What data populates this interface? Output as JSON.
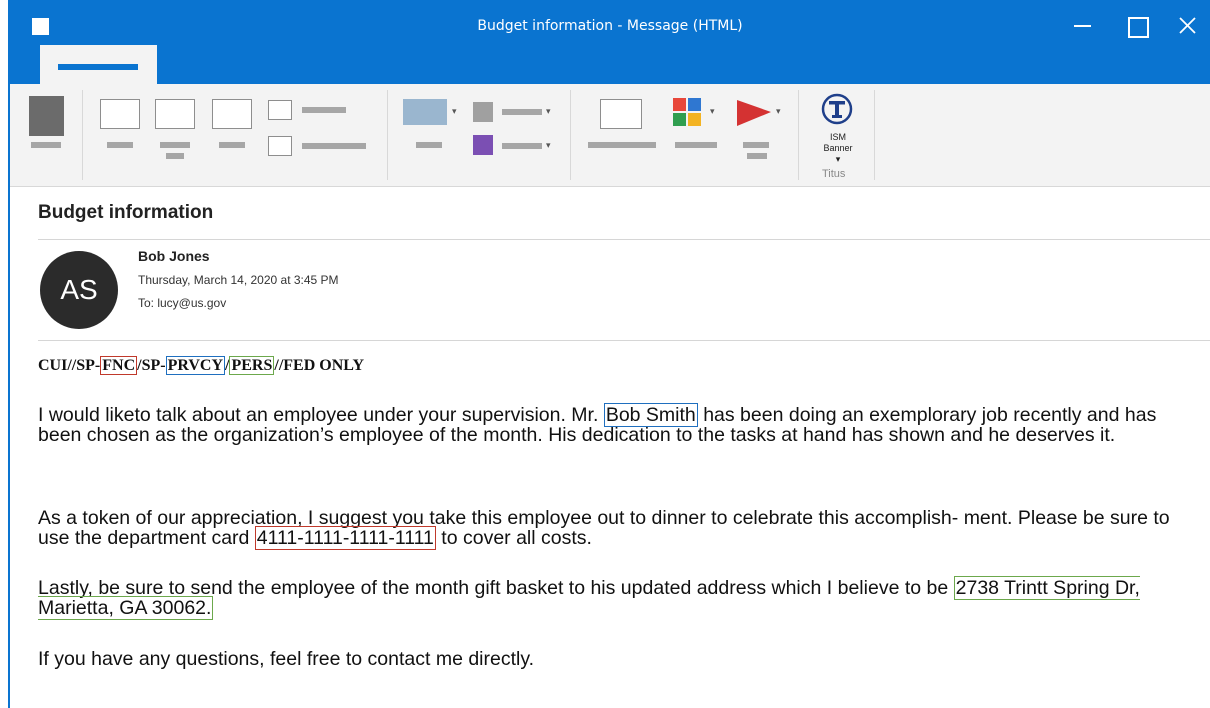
{
  "window": {
    "title": "Budget information - Message (HTML)"
  },
  "ribbon": {
    "titus": {
      "ism_line1": "ISM",
      "ism_line2": "Banner",
      "group_label": "Titus"
    }
  },
  "message": {
    "subject": "Budget information",
    "avatar_initials": "AS",
    "sender": "Bob Jones",
    "datetime": "Thursday, March 14, 2020 at 3:45 PM",
    "to": "To: lucy@us.gov",
    "banner": {
      "prefix": "CUI//SP-",
      "fnc": "FNC",
      "mid": "/SP-",
      "prvcy": "PRVCY",
      "slash": "/",
      "pers": "PERS",
      "suffix": "//FED ONLY"
    },
    "p1": {
      "before": "I would liketo talk about an employee under your supervision. Mr. ",
      "name": "Bob Smith",
      "after": " has been doing an exemplorary job recently and has been chosen as the organization’s employee of the month. His dedication to the tasks at hand has shown and he deserves it."
    },
    "p2": {
      "before": "As a token of our appreciation, I suggest you take this employee out to dinner to celebrate this accomplish- ment. Please be sure to use the department card ",
      "card": "4111-1111-1111-1111",
      "after": " to cover all costs."
    },
    "p3": {
      "before": "Lastly, be sure to send the employee of the month gift basket to his updated address which I believe to be ",
      "address": "2738 Trintt Spring Dr, Marietta, GA 30062."
    },
    "p4": "If you have any questions, feel free to contact me directly."
  },
  "colors": {
    "titlebar": "#0a74d0",
    "highlight_red": "#c0392b",
    "highlight_blue": "#1f6fbf",
    "highlight_green": "#6ca84c"
  }
}
